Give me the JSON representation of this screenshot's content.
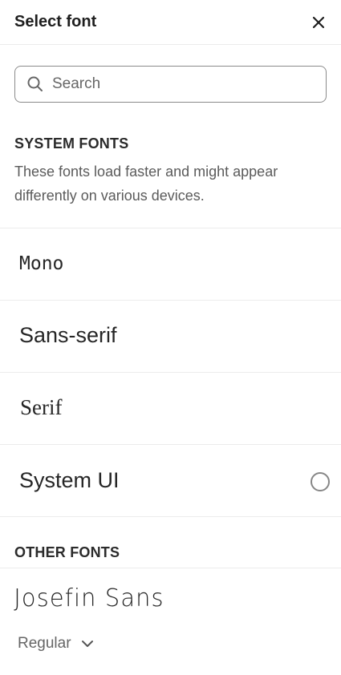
{
  "dialog": {
    "title": "Select font",
    "close_icon": "close-icon"
  },
  "search": {
    "placeholder": "Search",
    "value": "",
    "icon": "search-icon"
  },
  "system_fonts": {
    "heading": "SYSTEM FONTS",
    "description": "These fonts load faster and might appear differently on various devices.",
    "items": [
      {
        "label": "Mono",
        "selected": false
      },
      {
        "label": "Sans-serif",
        "selected": false
      },
      {
        "label": "Serif",
        "selected": false
      },
      {
        "label": "System UI",
        "selected": false
      }
    ]
  },
  "other_fonts": {
    "heading": "OTHER FONTS",
    "items": [
      {
        "label": "Josefin Sans",
        "variant": "Regular",
        "variant_icon": "chevron-down-icon"
      }
    ]
  }
}
